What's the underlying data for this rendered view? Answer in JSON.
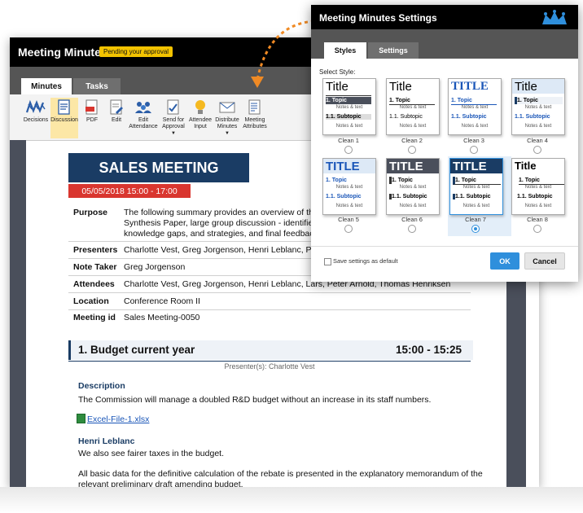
{
  "main": {
    "app_title": "Meeting Minutes",
    "status_badge": "Pending your approval",
    "tabs": [
      "Minutes",
      "Tasks"
    ],
    "ribbon": [
      {
        "label": "Decisions",
        "icon": "decisions-icon"
      },
      {
        "label": "Discussion",
        "icon": "discussion-icon"
      },
      {
        "label": "PDF",
        "icon": "pdf-icon"
      },
      {
        "label": "Edit",
        "icon": "edit-icon"
      },
      {
        "label": "Edit Attendance",
        "icon": "attendance-icon"
      },
      {
        "label": "Send for Approval",
        "icon": "send-approval-icon"
      },
      {
        "label": "Attendee Input",
        "icon": "lightbulb-icon"
      },
      {
        "label": "Distribute Minutes",
        "icon": "distribute-icon"
      },
      {
        "label": "Meeting Attributes",
        "icon": "attributes-icon"
      }
    ]
  },
  "doc": {
    "banner": "SALES MEETING",
    "date": "05/05/2018 15:00 - 17:00",
    "rows": [
      {
        "label": "Purpose",
        "lines": [
          "The following summary provides an overview of the me",
          "Synthesis Paper, large group discussion - identified ther",
          "knowledge gaps, and strategies, and final feedback."
        ]
      },
      {
        "label": "Presenters",
        "lines": [
          "Charlotte Vest, Greg Jorgenson, Henri Leblanc, Peter Ar"
        ]
      },
      {
        "label": "Note Taker",
        "lines": [
          "Greg Jorgenson"
        ]
      },
      {
        "label": "Attendees",
        "lines": [
          "Charlotte Vest, Greg Jorgenson, Henri Leblanc, Lars, Peter Arnold, Thomas Henriksen"
        ]
      },
      {
        "label": "Location",
        "lines": [
          "Conference Room II"
        ]
      },
      {
        "label": "Meeting id",
        "lines": [
          "Sales Meeting-0050"
        ]
      }
    ],
    "agenda_title": "1. Budget current year",
    "agenda_time": "15:00 - 15:25",
    "presenter": "Presenter(s): Charlotte Vest",
    "description_heading": "Description",
    "description": "The Commission will manage a doubled R&D budget without an increase in its staff numbers.",
    "file_link": "Excel-File-1.xlsx",
    "commenter": "Henri Leblanc",
    "comment": "We also see fairer taxes in the budget.",
    "para1": "All basic data for the definitive calculation of the rebate is presented in the explanatory memorandum of  the",
    "para2": "relevant preliminary draft amending budget."
  },
  "dialog": {
    "title": "Meeting Minutes Settings",
    "tabs": [
      "Styles",
      "Settings"
    ],
    "select_label": "Select Style:",
    "card_text": {
      "title": "Title",
      "title_caps": "TITLE",
      "topic": "1. Topic",
      "notes": "Notes & text",
      "subtopic": "1.1. Subtopic"
    },
    "styles": [
      "Clean 1",
      "Clean 2",
      "Clean 3",
      "Clean 4",
      "Clean 5",
      "Clean 6",
      "Clean 7",
      "Clean 8"
    ],
    "selected_style": "Clean 7",
    "save_default": "Save settings as default",
    "ok": "OK",
    "cancel": "Cancel",
    "colors": {
      "accent": "#2f8fdc",
      "navy": "#1a3c64",
      "red": "#d9362f",
      "badge": "#f3c300"
    }
  }
}
